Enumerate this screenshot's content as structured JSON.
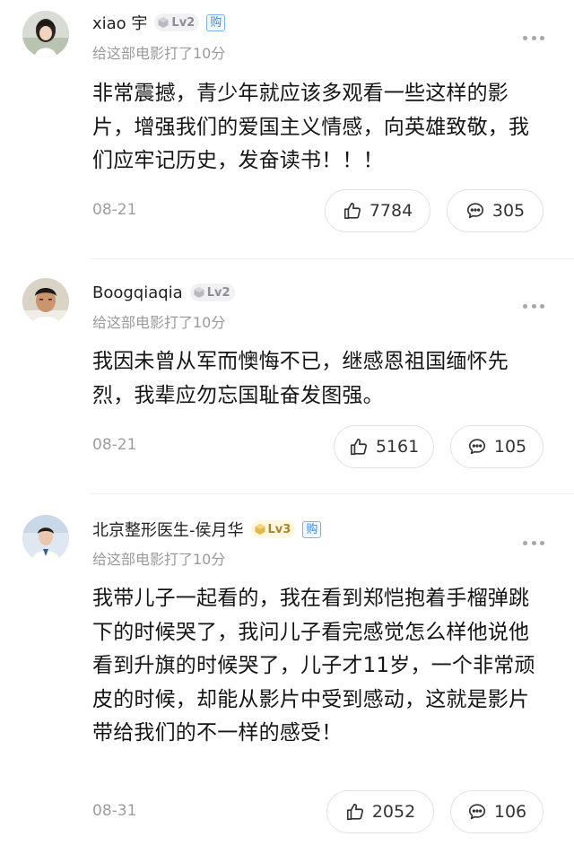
{
  "comments": [
    {
      "username": "xiao 宇",
      "level": "Lv2",
      "buy_badge": "购",
      "rating_text": "给这部电影打了10分",
      "text": "非常震撼，青少年就应该多观看一些这样的影片，增强我们的爱国主义情感，向英雄致敬，我们应牢记历史，发奋读书！！！",
      "date": "08-21",
      "likes": "7784",
      "replies": "305"
    },
    {
      "username": "Boogqiaqia",
      "level": "Lv2",
      "buy_badge": "",
      "rating_text": "给这部电影打了10分",
      "text": "我因未曾从军而懊悔不已，继感恩祖国缅怀先烈，我辈应勿忘国耻奋发图强。",
      "date": "08-21",
      "likes": "5161",
      "replies": "105"
    },
    {
      "username": "北京整形医生-侯月华",
      "level": "Lv3",
      "buy_badge": "购",
      "rating_text": "给这部电影打了10分",
      "text": "我带儿子一起看的，我在看到郑恺抱着手榴弹跳下的时候哭了，我问儿子看完感觉怎么样他说他看到升旗的时候哭了，儿子才11岁，一个非常顽皮的时候，却能从影片中受到感动，这就是影片带给我们的不一样的感受！",
      "date": "08-31",
      "likes": "2052",
      "replies": "106"
    }
  ],
  "icons": {
    "like": "thumbs-up-icon",
    "reply": "comment-bubble-icon",
    "more": "more-dots-icon"
  }
}
